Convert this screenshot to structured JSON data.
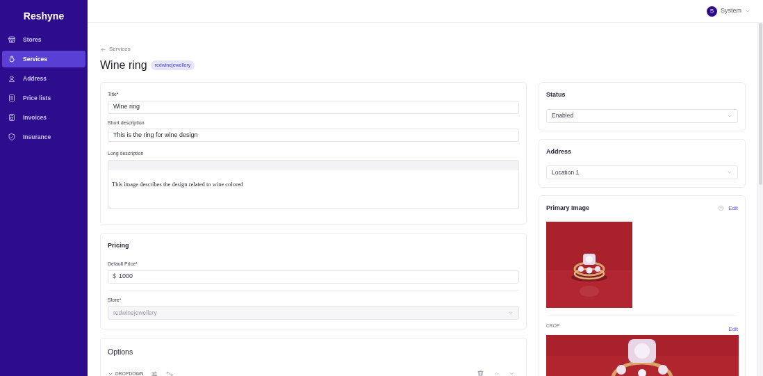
{
  "app": {
    "name": "Reshyne"
  },
  "sidebar": {
    "items": [
      {
        "label": "Stores",
        "selected": false
      },
      {
        "label": "Services",
        "selected": true
      },
      {
        "label": "Address",
        "selected": false
      },
      {
        "label": "Price lists",
        "selected": false
      },
      {
        "label": "Invoices",
        "selected": false
      },
      {
        "label": "Insurance",
        "selected": false
      }
    ]
  },
  "user_menu": {
    "initial": "S",
    "name": "System"
  },
  "back_link": "Services",
  "page": {
    "title": "Wine ring",
    "badge": "redwinejewellery"
  },
  "general": {
    "title": {
      "label": "Title*",
      "value": "Wine ring"
    },
    "short_description": {
      "label": "Short description",
      "value": "This is the ring for wine design"
    },
    "long_description": {
      "label": "Long description",
      "value": "This image describes the design related to wine colored"
    }
  },
  "pricing": {
    "heading": "Pricing",
    "default_price": {
      "label": "Default Price*",
      "currency": "$",
      "value": "1000"
    },
    "store": {
      "label": "Store*",
      "value": "redwinejewellery",
      "disabled": true
    }
  },
  "options": {
    "heading": "Options",
    "items": [
      {
        "type": "DROPDOWN",
        "expanded": true
      }
    ]
  },
  "status": {
    "heading": "Status",
    "value": "Enabled"
  },
  "address": {
    "heading": "Address",
    "value": "Location 1"
  },
  "primary_image": {
    "heading": "Primary Image",
    "edit": "Edit",
    "crop_label": "CROP",
    "crop_edit": "Edit"
  }
}
